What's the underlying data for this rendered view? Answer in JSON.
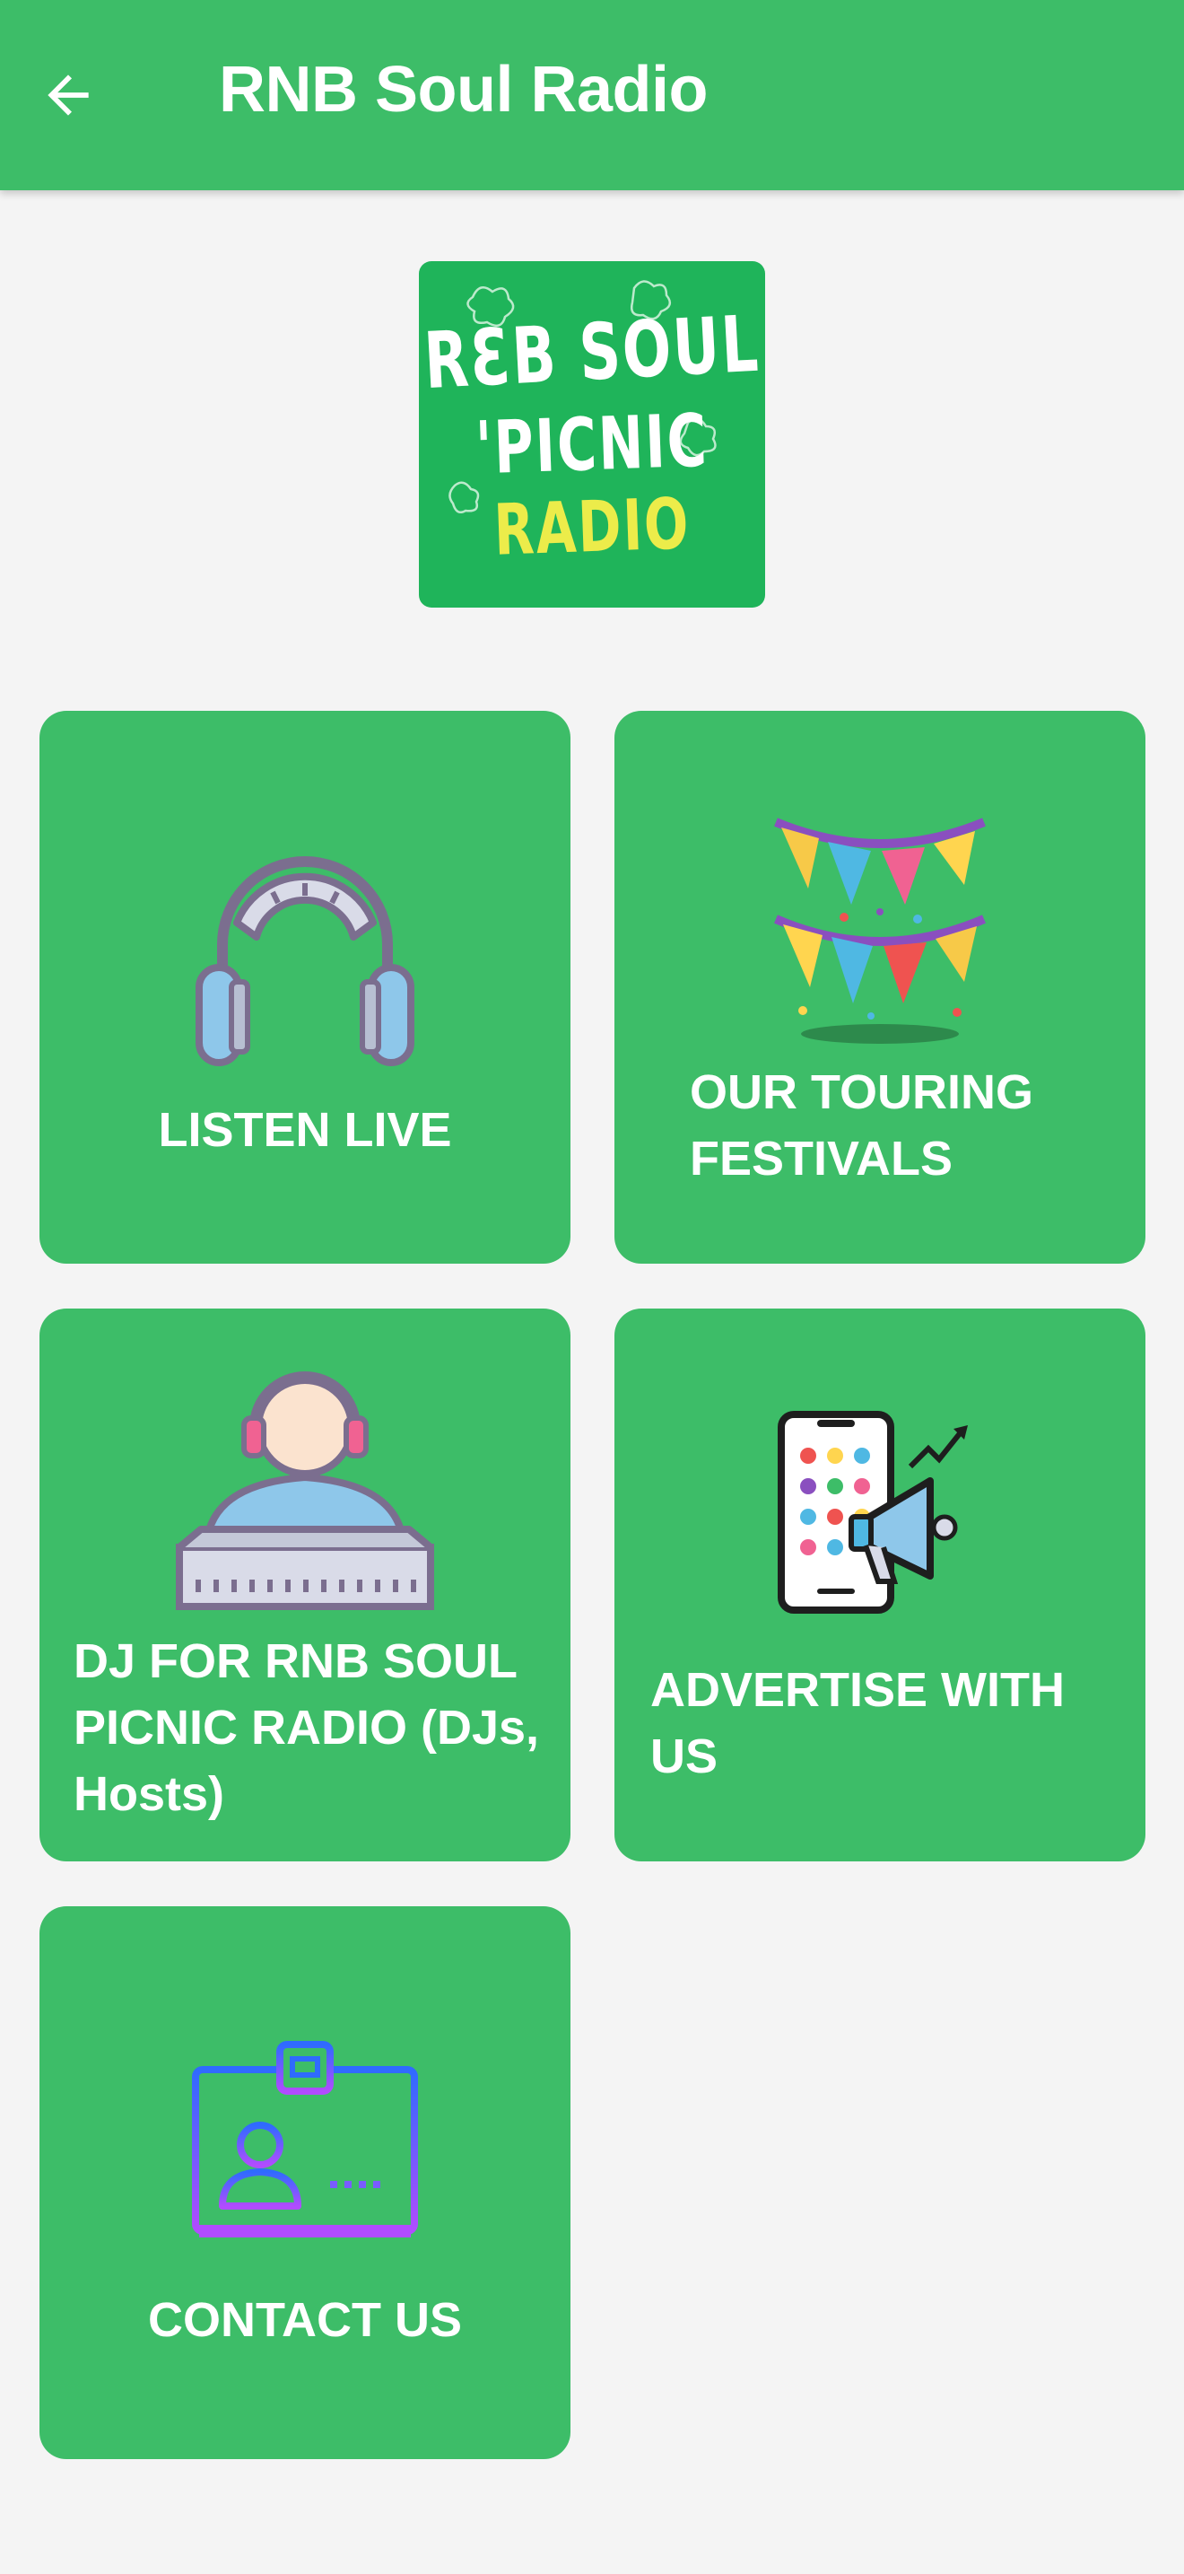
{
  "app_bar": {
    "title": "RNB Soul Radio",
    "back_icon": "arrow-left-icon"
  },
  "logo": {
    "line1": "RƐB SOUL",
    "line2": "'PICNIC",
    "line3": "RADIO",
    "background": "#1fb45a",
    "accent": "#ecec4a"
  },
  "tiles": [
    {
      "label": "LISTEN LIVE",
      "icon": "headphones-icon"
    },
    {
      "label": "OUR TOURING FESTIVALS",
      "icon": "bunting-icon"
    },
    {
      "label": "DJ FOR RNB SOUL PICNIC RADIO (DJs, Hosts)",
      "icon": "dj-icon"
    },
    {
      "label": "ADVERTISE WITH US",
      "icon": "phone-megaphone-icon"
    },
    {
      "label": "CONTACT US",
      "icon": "id-card-icon"
    }
  ],
  "colors": {
    "primary": "#3dbd68",
    "background": "#f4f4f4",
    "text_on_primary": "#ffffff"
  }
}
